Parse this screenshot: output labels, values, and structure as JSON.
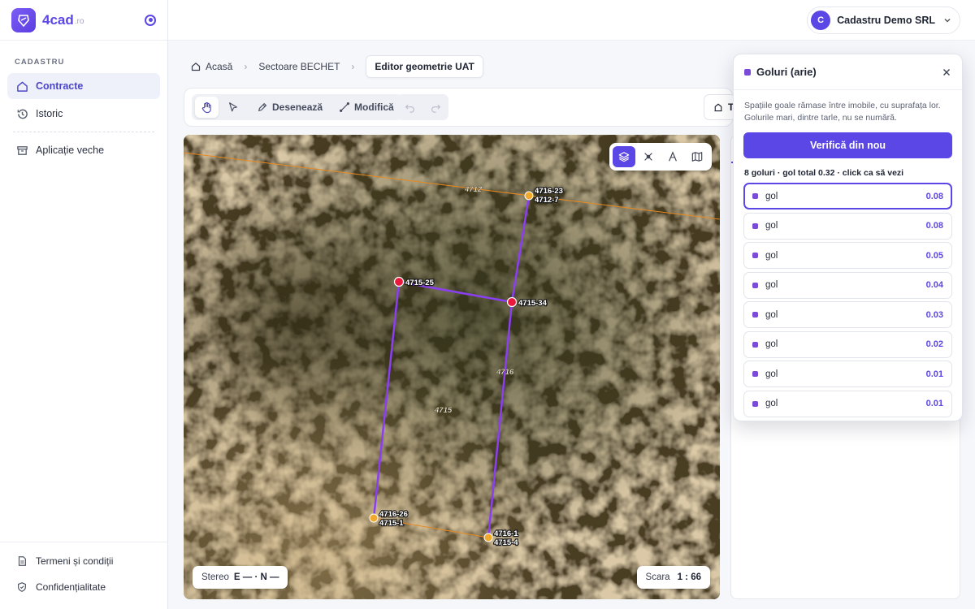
{
  "brand": {
    "name": "4cad",
    "tld": ".ro"
  },
  "sidebar": {
    "section": "CADASTRU",
    "items": [
      {
        "label": "Contracte",
        "icon": "home-icon",
        "active": true
      },
      {
        "label": "Istoric",
        "icon": "history-icon"
      },
      {
        "label": "Aplicație veche",
        "icon": "archive-icon"
      }
    ],
    "footer": [
      {
        "label": "Termeni și condiții",
        "icon": "document-icon"
      },
      {
        "label": "Confidențialitate",
        "icon": "shield-icon"
      }
    ]
  },
  "account": {
    "initial": "C",
    "name": "Cadastru Demo SRL"
  },
  "breadcrumb": {
    "home": "Acasă",
    "middle": "Sectoare BECHET",
    "current": "Editor geometrie UAT"
  },
  "toolbar": {
    "draw": "Desenează",
    "modify": "Modifică",
    "right_partial": "T"
  },
  "map": {
    "labels": {
      "parcel_4712": "4712",
      "parcel_4716": "4716",
      "parcel_4715": "4715"
    },
    "points": {
      "p_top": [
        "4716-23",
        "4712-7"
      ],
      "p_mid_left": [
        "4715-25"
      ],
      "p_mid_right": [
        "4715-34"
      ],
      "p_bottom_left": [
        "4716-26",
        "4715-1"
      ],
      "p_bottom_right": [
        "4716-1",
        "4715-4"
      ]
    },
    "stereo": {
      "label": "Stereo",
      "value": "E — · N —"
    },
    "scale": {
      "label": "Scara",
      "value": "1 : 66"
    }
  },
  "panel": {
    "title": "Goluri (arie)",
    "description": "Spațiile goale rămase între imobile, cu suprafața lor. Golurile mari, dintre tarle, nu se numără.",
    "verify_button": "Verifică din nou",
    "summary": "8 goluri · gol total 0.32 · click ca să vezi",
    "gaps": [
      {
        "label": "gol",
        "value": "0.08"
      },
      {
        "label": "gol",
        "value": "0.08"
      },
      {
        "label": "gol",
        "value": "0.05"
      },
      {
        "label": "gol",
        "value": "0.04"
      },
      {
        "label": "gol",
        "value": "0.03"
      },
      {
        "label": "gol",
        "value": "0.02"
      },
      {
        "label": "gol",
        "value": "0.01"
      },
      {
        "label": "gol",
        "value": "0.01"
      }
    ]
  },
  "colors": {
    "accent": "#5b46e6",
    "parcel_line": "#8a3ff0",
    "boundary_line": "#e8891e"
  }
}
